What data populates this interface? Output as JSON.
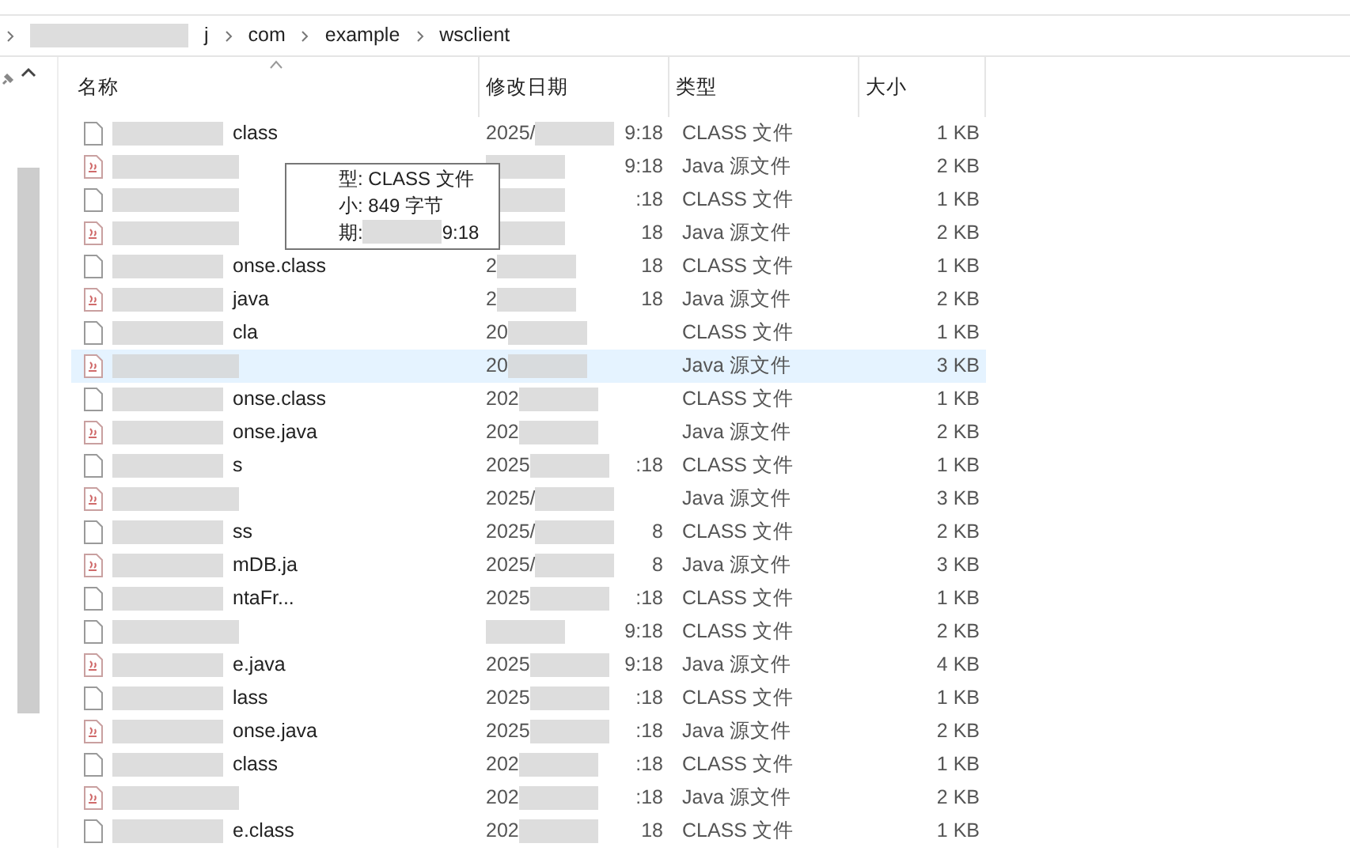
{
  "breadcrumb": [
    "j",
    "com",
    "example",
    "wsclient"
  ],
  "columns": [
    "名称",
    "修改日期",
    "类型",
    "大小"
  ],
  "tooltip": {
    "lines": [
      "型: CLASS 文件",
      "小: 849 字节",
      "期:"
    ],
    "tail": "9:18"
  },
  "rows": [
    {
      "kind": "class",
      "name": "class",
      "date_start": "2025/",
      "date_end": "9:18",
      "type": "CLASS 文件",
      "size": "1 KB",
      "selected": false
    },
    {
      "kind": "java",
      "name": "",
      "date_start": "",
      "date_end": "9:18",
      "type": "Java 源文件",
      "size": "2 KB",
      "selected": false
    },
    {
      "kind": "class",
      "name": "",
      "date_start": "",
      "date_end": ":18",
      "type": "CLASS 文件",
      "size": "1 KB",
      "selected": false
    },
    {
      "kind": "java",
      "name": "",
      "date_start": "",
      "date_end": "18",
      "type": "Java 源文件",
      "size": "2 KB",
      "selected": false
    },
    {
      "kind": "class",
      "name": "onse.class",
      "date_start": "2",
      "date_end": "18",
      "type": "CLASS 文件",
      "size": "1 KB",
      "selected": false
    },
    {
      "kind": "java",
      "name": "java",
      "date_start": "2",
      "date_end": "18",
      "type": "Java 源文件",
      "size": "2 KB",
      "selected": false
    },
    {
      "kind": "class",
      "name": "cla",
      "date_start": "20",
      "date_end": "",
      "type": "CLASS 文件",
      "size": "1 KB",
      "selected": false
    },
    {
      "kind": "java",
      "name": "",
      "date_start": "20",
      "date_end": "",
      "type": "Java 源文件",
      "size": "3 KB",
      "selected": true
    },
    {
      "kind": "class",
      "name": "onse.class",
      "date_start": "202",
      "date_end": "",
      "type": "CLASS 文件",
      "size": "1 KB",
      "selected": false
    },
    {
      "kind": "java",
      "name": "onse.java",
      "date_start": "202",
      "date_end": "",
      "type": "Java 源文件",
      "size": "2 KB",
      "selected": false
    },
    {
      "kind": "class",
      "name": "s",
      "date_start": "2025",
      "date_end": ":18",
      "type": "CLASS 文件",
      "size": "1 KB",
      "selected": false
    },
    {
      "kind": "java",
      "name": "",
      "date_start": "2025/",
      "date_end": "",
      "type": "Java 源文件",
      "size": "3 KB",
      "selected": false
    },
    {
      "kind": "class",
      "name": "ss",
      "date_start": "2025/",
      "date_end": "8",
      "type": "CLASS 文件",
      "size": "2 KB",
      "selected": false
    },
    {
      "kind": "java",
      "name": "mDB.ja",
      "date_start": "2025/",
      "date_end": "8",
      "type": "Java 源文件",
      "size": "3 KB",
      "selected": false
    },
    {
      "kind": "class",
      "name": "ntaFr...",
      "date_start": "2025",
      "date_end": ":18",
      "type": "CLASS 文件",
      "size": "1 KB",
      "selected": false
    },
    {
      "kind": "class",
      "name": "",
      "date_start": "",
      "date_end": "9:18",
      "type": "CLASS 文件",
      "size": "2 KB",
      "selected": false
    },
    {
      "kind": "java",
      "name": "e.java",
      "date_start": "2025",
      "date_end": "9:18",
      "type": "Java 源文件",
      "size": "4 KB",
      "selected": false
    },
    {
      "kind": "class",
      "name": "lass",
      "date_start": "2025",
      "date_end": ":18",
      "type": "CLASS 文件",
      "size": "1 KB",
      "selected": false
    },
    {
      "kind": "java",
      "name": "onse.java",
      "date_start": "2025",
      "date_end": ":18",
      "type": "Java 源文件",
      "size": "2 KB",
      "selected": false
    },
    {
      "kind": "class",
      "name": "class",
      "date_start": "202",
      "date_end": ":18",
      "type": "CLASS 文件",
      "size": "1 KB",
      "selected": false
    },
    {
      "kind": "java",
      "name": "",
      "date_start": "202",
      "date_end": ":18",
      "type": "Java 源文件",
      "size": "2 KB",
      "selected": false
    },
    {
      "kind": "class",
      "name": "e.class",
      "date_start": "202",
      "date_end": "18",
      "type": "CLASS 文件",
      "size": "1 KB",
      "selected": false
    }
  ]
}
